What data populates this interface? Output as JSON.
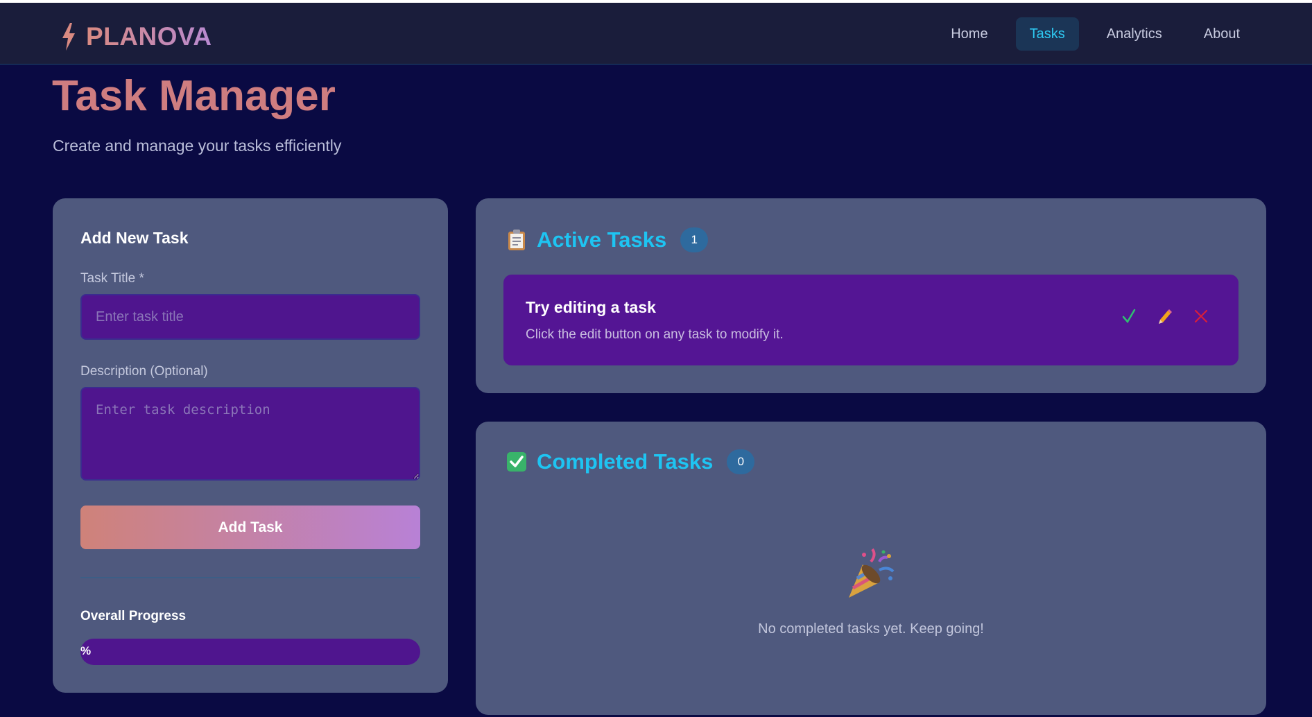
{
  "brand": {
    "name": "PLANOVA",
    "icon": "bolt-icon",
    "gradient": [
      "#d98a82",
      "#b88ad2"
    ]
  },
  "nav": {
    "items": [
      {
        "label": "Home",
        "active": false
      },
      {
        "label": "Tasks",
        "active": true
      },
      {
        "label": "Analytics",
        "active": false
      },
      {
        "label": "About",
        "active": false
      }
    ]
  },
  "page": {
    "title": "Task Manager",
    "subtitle": "Create and manage your tasks efficiently"
  },
  "form": {
    "heading": "Add New Task",
    "title_label": "Task Title *",
    "title_placeholder": "Enter task title",
    "title_value": "",
    "description_label": "Description (Optional)",
    "description_placeholder": "Enter task description",
    "description_value": "",
    "submit_label": "Add Task",
    "progress_label": "Overall Progress",
    "progress_text": "%",
    "progress_value": 0
  },
  "active_tasks": {
    "icon": "clipboard-icon",
    "title": "Active Tasks",
    "count": "1",
    "items": [
      {
        "title": "Try editing a task",
        "description": "Click the edit button on any task to modify it.",
        "actions": [
          "complete-check-icon",
          "edit-pencil-icon",
          "delete-x-icon"
        ]
      }
    ]
  },
  "completed_tasks": {
    "icon": "checkbox-checked-icon",
    "title": "Completed Tasks",
    "count": "0",
    "empty_icon": "party-popper-icon",
    "empty_message": "No completed tasks yet. Keep going!"
  },
  "colors": {
    "background": "#0a0a43",
    "card": "#4f597e",
    "accent_cyan": "#1ec4f2",
    "task_purple": "#541594",
    "title_salmon": "#cf7d80"
  }
}
